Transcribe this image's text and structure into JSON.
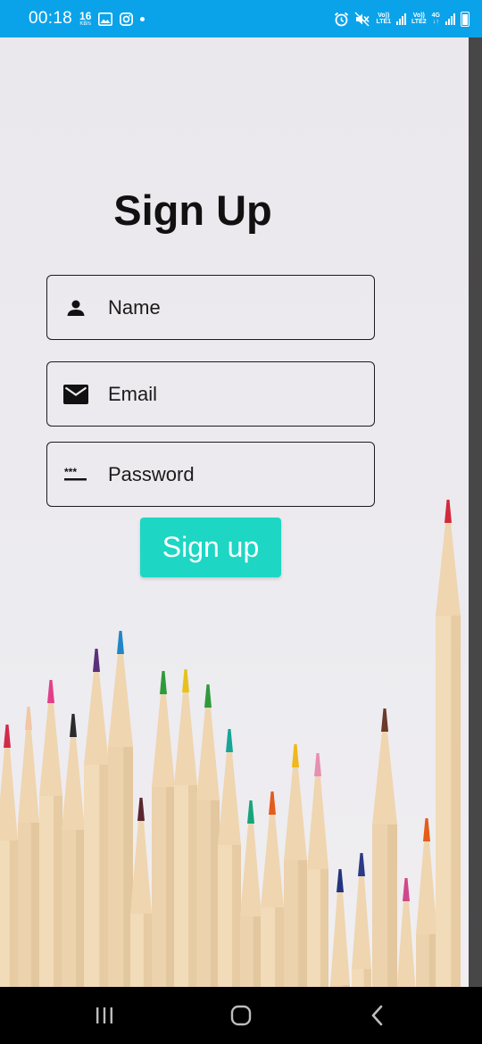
{
  "status_bar": {
    "time": "00:18",
    "speed_value": "16",
    "speed_unit": "KB/s",
    "sim1_label_top": "Vo))",
    "sim1_label_bottom": "LTE1",
    "sim2_label_top": "Vo))",
    "sim2_label_bottom": "LTE2",
    "network_type": "4G",
    "left_icons": [
      "image-icon",
      "instagram-icon",
      "notification-dot"
    ],
    "right_icons": [
      "alarm-icon",
      "mute-icon",
      "signal-icon",
      "battery-icon"
    ]
  },
  "signup": {
    "title": "Sign Up",
    "name_placeholder": "Name",
    "email_placeholder": "Email",
    "password_placeholder": "Password",
    "button_label": "Sign up"
  },
  "colors": {
    "status_bar": "#0aa3ea",
    "button": "#1dd6c3",
    "background": "#ece9ee"
  },
  "nav_bar": {
    "icons": [
      "recent-apps-icon",
      "home-icon",
      "back-icon"
    ]
  }
}
